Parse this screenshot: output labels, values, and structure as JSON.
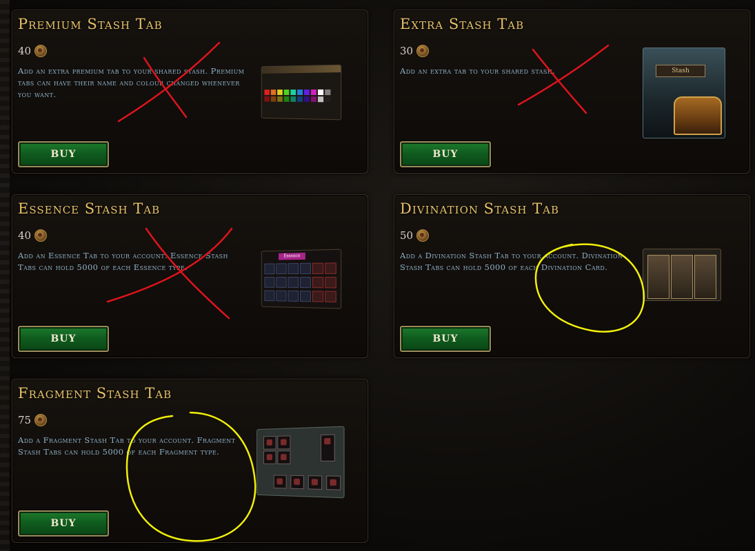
{
  "cards": [
    {
      "title": "Premium Stash Tab",
      "price": "40",
      "description": "Add an extra premium tab to your shared stash. Premium tabs can have their name and colour changed whenever you want.",
      "buy_label": "BUY",
      "thumbnail": "premium-tab-thumbnail",
      "marking": "red-x"
    },
    {
      "title": "Extra Stash Tab",
      "price": "30",
      "description": "Add an extra tab to your shared stash.",
      "buy_label": "BUY",
      "thumbnail": "stash-chest-thumbnail",
      "thumbnail_label": "Stash",
      "marking": "red-x"
    },
    {
      "title": "Essence Stash Tab",
      "price": "40",
      "description": "Add an Essence Tab to your account. Essence Stash Tabs can hold 5000 of each Essence type.",
      "buy_label": "BUY",
      "thumbnail": "essence-tab-thumbnail",
      "thumbnail_label": "Essence",
      "marking": "red-x"
    },
    {
      "title": "Divination Stash Tab",
      "price": "50",
      "description": "Add a Divination Stash Tab to your account. Divination Stash Tabs can hold 5000 of each Divination Card.",
      "buy_label": "BUY",
      "thumbnail": "divination-tab-thumbnail",
      "marking": "yellow-circle"
    },
    {
      "title": "Fragment Stash Tab",
      "price": "75",
      "description": "Add a Fragment Stash Tab to your account. Fragment Stash Tabs can hold 5000 of each Fragment type.",
      "buy_label": "BUY",
      "thumbnail": "fragment-tab-thumbnail",
      "marking": "yellow-circle"
    }
  ],
  "colors": {
    "title": "#e8c46a",
    "description": "#8fb2c8",
    "buy_button": "#1d7a2c",
    "red_mark": "#e0141c",
    "yellow_mark": "#f2f00a"
  },
  "icons": {
    "price": "coin-icon"
  }
}
